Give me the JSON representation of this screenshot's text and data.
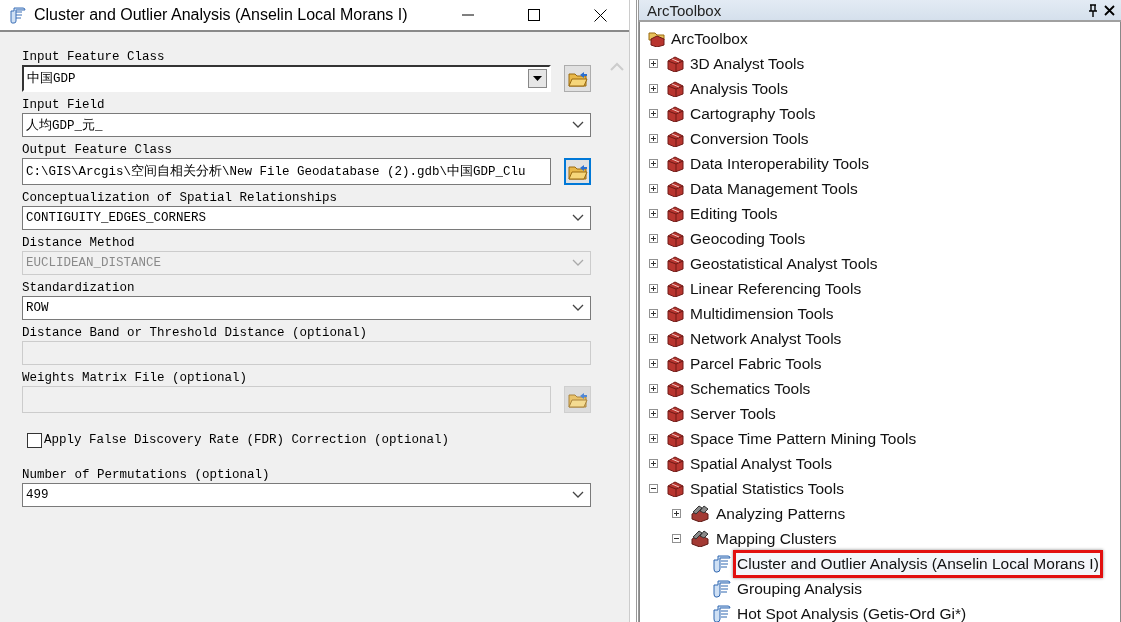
{
  "dialog": {
    "title": "Cluster and Outlier Analysis (Anselin Local Morans I)",
    "parameters": [
      {
        "kind": "dropdown-classic",
        "label": "Input Feature Class",
        "value": "中国GDP",
        "disabled": false,
        "browse": true,
        "focused": false
      },
      {
        "kind": "combo",
        "label": "Input Field",
        "value": "人均GDP_元_",
        "disabled": false
      },
      {
        "kind": "text",
        "label": "Output Feature Class",
        "value": "C:\\GIS\\Arcgis\\空间自相关分析\\New File Geodatabase (2).gdb\\中国GDP_Clu",
        "disabled": false,
        "browse": true,
        "focused": true
      },
      {
        "kind": "combo",
        "label": "Conceptualization of Spatial Relationships",
        "value": "CONTIGUITY_EDGES_CORNERS",
        "disabled": false
      },
      {
        "kind": "combo",
        "label": "Distance Method",
        "value": "EUCLIDEAN_DISTANCE",
        "disabled": true
      },
      {
        "kind": "combo",
        "label": "Standardization",
        "value": "ROW",
        "disabled": false
      },
      {
        "kind": "text",
        "label": "Distance Band or Threshold Distance (optional)",
        "disabled": true
      },
      {
        "kind": "text",
        "label": "Weights Matrix File (optional)",
        "disabled": true,
        "browse": true,
        "focused": false
      },
      {
        "kind": "checkbox",
        "label": "Apply False Discovery Rate (FDR) Correction (optional)",
        "checked": false
      },
      {
        "kind": "combo",
        "label": "Number of Permutations (optional)",
        "value": "499",
        "disabled": false
      }
    ]
  },
  "toolbox": {
    "title": "ArcToolbox",
    "tree": {
      "kind": "root",
      "label": "ArcToolbox",
      "selected": false,
      "children": [
        {
          "kind": "toolbox",
          "label": "3D Analyst Tools",
          "expanded": false,
          "selected": false
        },
        {
          "kind": "toolbox",
          "label": "Analysis Tools",
          "expanded": false,
          "selected": false
        },
        {
          "kind": "toolbox",
          "label": "Cartography Tools",
          "expanded": false,
          "selected": false
        },
        {
          "kind": "toolbox",
          "label": "Conversion Tools",
          "expanded": false,
          "selected": false
        },
        {
          "kind": "toolbox",
          "label": "Data Interoperability Tools",
          "expanded": false,
          "selected": false
        },
        {
          "kind": "toolbox",
          "label": "Data Management Tools",
          "expanded": false,
          "selected": false
        },
        {
          "kind": "toolbox",
          "label": "Editing Tools",
          "expanded": false,
          "selected": false
        },
        {
          "kind": "toolbox",
          "label": "Geocoding Tools",
          "expanded": false,
          "selected": false
        },
        {
          "kind": "toolbox",
          "label": "Geostatistical Analyst Tools",
          "expanded": false,
          "selected": false
        },
        {
          "kind": "toolbox",
          "label": "Linear Referencing Tools",
          "expanded": false,
          "selected": false
        },
        {
          "kind": "toolbox",
          "label": "Multidimension Tools",
          "expanded": false,
          "selected": false
        },
        {
          "kind": "toolbox",
          "label": "Network Analyst Tools",
          "expanded": false,
          "selected": false
        },
        {
          "kind": "toolbox",
          "label": "Parcel Fabric Tools",
          "expanded": false,
          "selected": false
        },
        {
          "kind": "toolbox",
          "label": "Schematics Tools",
          "expanded": false,
          "selected": false
        },
        {
          "kind": "toolbox",
          "label": "Server Tools",
          "expanded": false,
          "selected": false
        },
        {
          "kind": "toolbox",
          "label": "Space Time Pattern Mining Tools",
          "expanded": false,
          "selected": false
        },
        {
          "kind": "toolbox",
          "label": "Spatial Analyst Tools",
          "expanded": false,
          "selected": false
        },
        {
          "kind": "toolbox",
          "label": "Spatial Statistics Tools",
          "expanded": true,
          "selected": false,
          "children": [
            {
              "kind": "toolset",
              "label": "Analyzing Patterns",
              "expanded": false,
              "selected": false
            },
            {
              "kind": "toolset",
              "label": "Mapping Clusters",
              "expanded": true,
              "selected": false,
              "children": [
                {
                  "kind": "tool",
                  "label": "Cluster and Outlier Analysis (Anselin Local Morans I)",
                  "selected": true
                },
                {
                  "kind": "tool",
                  "label": "Grouping Analysis",
                  "selected": false
                },
                {
                  "kind": "tool",
                  "label": "Hot Spot Analysis (Getis-Ord Gi*)",
                  "selected": false
                }
              ]
            }
          ]
        }
      ]
    }
  }
}
